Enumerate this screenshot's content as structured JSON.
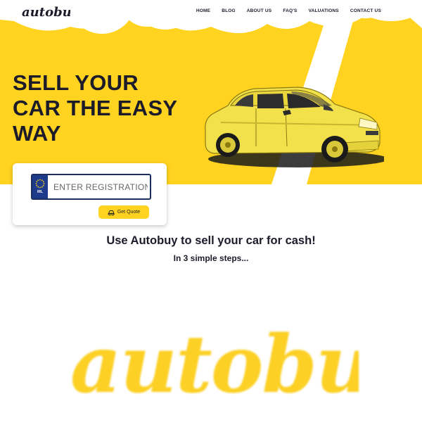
{
  "header": {
    "logo_text": "autobuy",
    "nav": [
      {
        "label": "HOME",
        "active": true
      },
      {
        "label": "BLOG",
        "active": false
      },
      {
        "label": "ABOUT US",
        "active": false
      },
      {
        "label": "FAQ'S",
        "active": false
      },
      {
        "label": "VALUATIONS",
        "active": false
      },
      {
        "label": "CONTACT US",
        "active": false
      }
    ]
  },
  "hero": {
    "headline_lines": [
      "SELL YOUR",
      "CAR THE EASY",
      "WAY"
    ],
    "car_image": "yellow-hatchback-car"
  },
  "registration": {
    "placeholder": "ENTER REGISTRATION",
    "plate_country": "IRL",
    "eu_flag_icon": "eu-stars-icon",
    "button_label": "Get Quote",
    "button_icon": "car-quote-icon"
  },
  "steps": {
    "title": "Use Autobuy to sell your car for cash!",
    "subtitle": "In 3 simple steps..."
  },
  "footer_logo": {
    "text": "autobuy"
  },
  "colors": {
    "brand_yellow": "#ffd31f",
    "dark_text": "#1b1b2a",
    "plate_blue": "#1e3a8a"
  }
}
